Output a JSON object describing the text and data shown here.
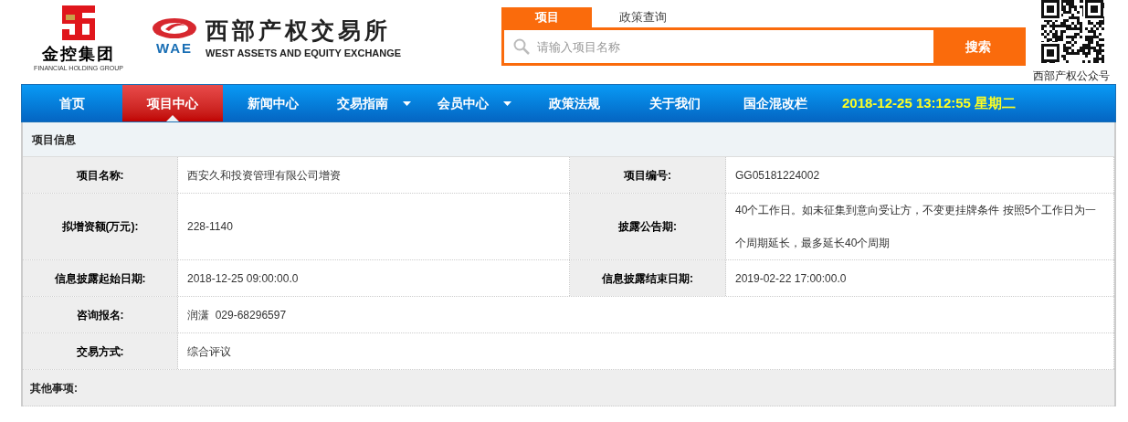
{
  "header": {
    "group_logo": {
      "name": "金控集团",
      "subtitle": "FINANCIAL HOLDING GROUP"
    },
    "exchange_logo": {
      "abbr": "WAE",
      "name": "西部产权交易所",
      "subtitle": "WEST ASSETS AND EQUITY EXCHANGE"
    },
    "search": {
      "tabs": [
        {
          "label": "项目",
          "selected": true
        },
        {
          "label": "政策查询",
          "selected": false
        }
      ],
      "placeholder": "请输入项目名称",
      "button": "搜索"
    },
    "qr_caption": "西部产权公众号"
  },
  "nav": {
    "items": [
      {
        "label": "首页",
        "selected": false,
        "dropdown": false
      },
      {
        "label": "项目中心",
        "selected": true,
        "dropdown": false
      },
      {
        "label": "新闻中心",
        "selected": false,
        "dropdown": false
      },
      {
        "label": "交易指南",
        "selected": false,
        "dropdown": true
      },
      {
        "label": "会员中心",
        "selected": false,
        "dropdown": true
      },
      {
        "label": "政策法规",
        "selected": false,
        "dropdown": false
      },
      {
        "label": "关于我们",
        "selected": false,
        "dropdown": false
      },
      {
        "label": "国企混改栏",
        "selected": false,
        "dropdown": false
      }
    ],
    "datetime": "2018-12-25 13:12:55 星期二"
  },
  "panel": {
    "title": "项目信息",
    "rows": [
      {
        "label": "项目名称:",
        "value": "西安久和投资管理有限公司增资",
        "label2": "项目编号:",
        "value2": "GG05181224002"
      },
      {
        "label": "拟增资额(万元):",
        "value": "228-1140",
        "label2": "披露公告期:",
        "value2": "40个工作日。如未征集到意向受让方，不变更挂牌条件 按照5个工作日为一个周期延长，最多延长40个周期"
      },
      {
        "label": "信息披露起始日期:",
        "value": "2018-12-25 09:00:00.0",
        "label2": "信息披露结束日期:",
        "value2": "2019-02-22 17:00:00.0"
      },
      {
        "label": "咨询报名:",
        "value": "润潇  029-68296597"
      },
      {
        "label": "交易方式:",
        "value": "综合评议"
      }
    ],
    "other_label": "其他事项:"
  }
}
